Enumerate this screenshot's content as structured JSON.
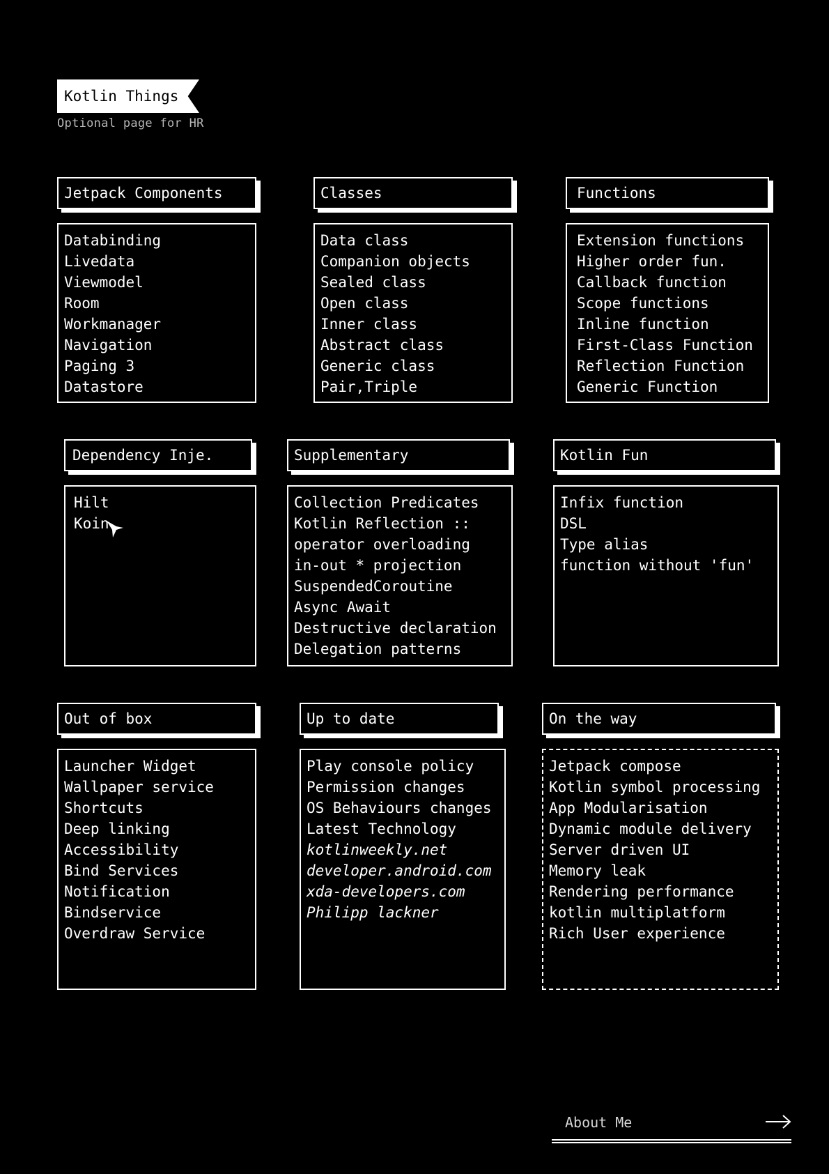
{
  "header": {
    "title": "Kotlin Things",
    "subtitle": "Optional page for HR"
  },
  "sections": [
    {
      "title": "Jetpack Components",
      "items": [
        "Databinding",
        "Livedata",
        "Viewmodel",
        "Room",
        "Workmanager",
        "Navigation",
        "Paging 3",
        "Datastore"
      ]
    },
    {
      "title": "Classes",
      "items": [
        "Data class",
        "Companion objects",
        "Sealed class",
        "Open class",
        "Inner class",
        "Abstract class",
        "Generic class",
        "Pair,Triple"
      ]
    },
    {
      "title": "Functions",
      "items": [
        "Extension functions",
        "Higher order fun.",
        "Callback function",
        "Scope functions",
        "Inline function",
        "First-Class Function",
        "Reflection Function",
        "Generic Function"
      ]
    },
    {
      "title": "Dependency Inje.",
      "items": [
        "Hilt",
        "Koin"
      ]
    },
    {
      "title": "Supplementary",
      "items": [
        "Collection Predicates",
        "Kotlin Reflection ::",
        "operator overloading",
        "in-out * projection",
        "SuspendedCoroutine",
        "Async Await",
        "Destructive declaration",
        "Delegation patterns"
      ]
    },
    {
      "title": "Kotlin Fun",
      "items": [
        "Infix function",
        "DSL",
        "Type alias",
        "function without 'fun'"
      ]
    },
    {
      "title": "Out of box",
      "items": [
        "Launcher Widget",
        "Wallpaper service",
        "Shortcuts",
        "Deep linking",
        "Accessibility",
        "Bind Services",
        "Notification",
        "Bindservice",
        "Overdraw Service"
      ]
    },
    {
      "title": "Up to date",
      "items": [
        "Play console policy",
        "Permission changes",
        "OS Behaviours changes",
        "Latest Technology"
      ],
      "links": [
        "kotlinweekly.net",
        "developer.android.com",
        "xda-developers.com",
        "Philipp lackner"
      ]
    },
    {
      "title": "On the way",
      "items": [
        "Jetpack compose",
        "Kotlin symbol processing",
        "App Modularisation",
        "Dynamic module delivery",
        "Server driven UI",
        "Memory leak",
        "Rendering performance",
        "kotlin multiplatform",
        "Rich User experience"
      ]
    }
  ],
  "footer": {
    "about_label": "About Me",
    "arrow_icon": "arrow-right-icon"
  },
  "colors": {
    "background": "#000000",
    "foreground": "#ffffff"
  }
}
